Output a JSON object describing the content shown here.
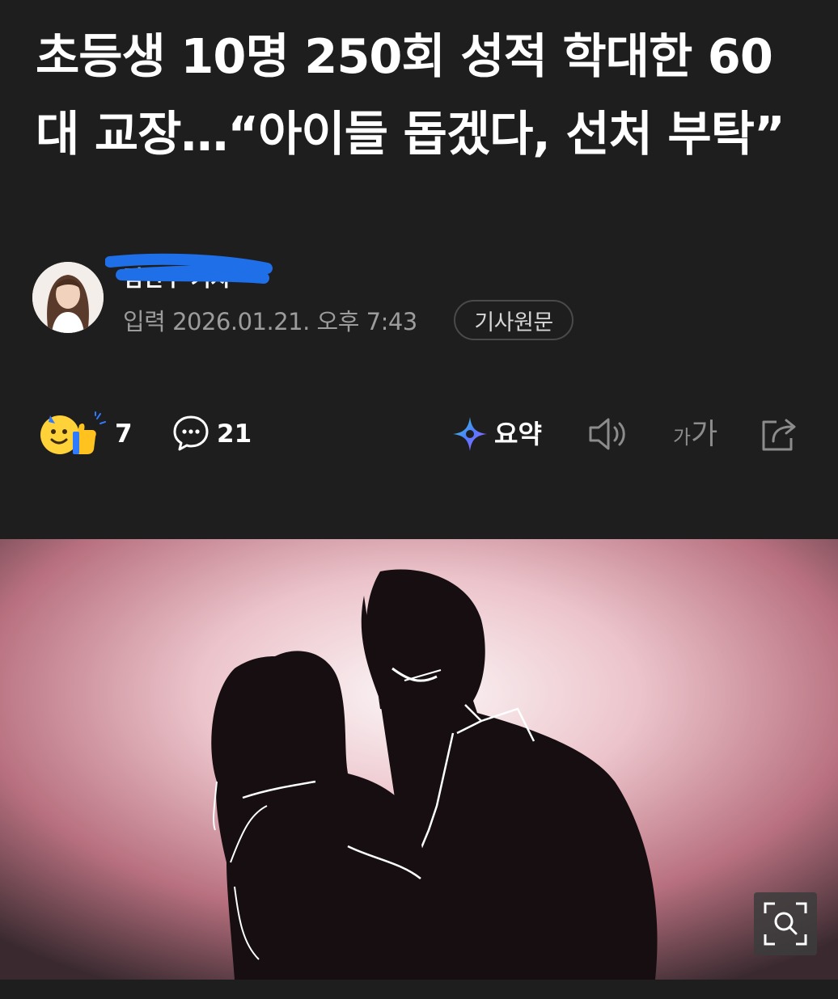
{
  "article": {
    "headline": "초등생 10명 250회 성적 학대한 60대 교장…“아이들 돕겠다, 선처 부탁”",
    "reporter_name": "김민주 기자",
    "published_label": "입력 2026.01.21. 오후 7:43",
    "source_button": "기사원문"
  },
  "actions": {
    "reaction_count": "7",
    "comment_count": "21",
    "summary_label": "요약",
    "font_small": "가",
    "font_large": "가"
  },
  "icons": {
    "reaction": "smile-thumbs-up-icon",
    "comment": "speech-bubble-icon",
    "summary": "sparkle-icon",
    "audio": "speaker-icon",
    "font_size": "font-size-icon",
    "share": "share-icon",
    "zoom": "zoom-magnifier-icon"
  },
  "colors": {
    "background": "#1e1e1f",
    "text_primary": "#ffffff",
    "text_secondary": "#9c9c9c",
    "scribble": "#1e6fe8"
  }
}
